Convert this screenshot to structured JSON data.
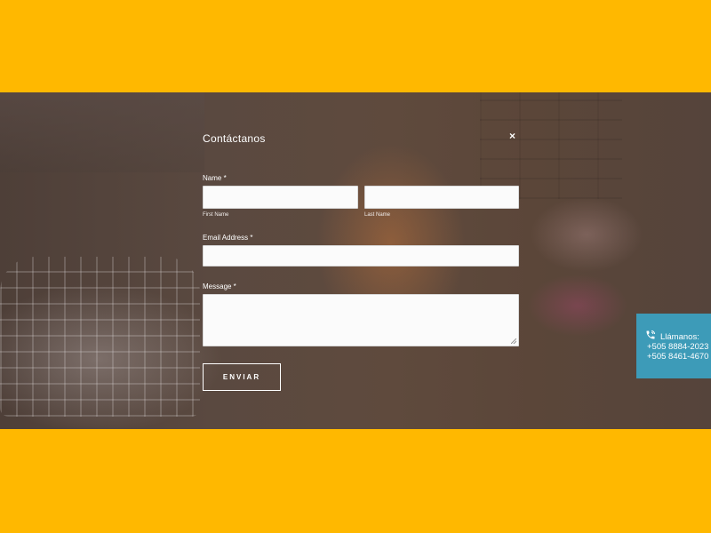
{
  "modal": {
    "title": "Contáctanos",
    "close_symbol": "×"
  },
  "form": {
    "name_label": "Name *",
    "first_name_sublabel": "First Name",
    "last_name_sublabel": "Last Name",
    "first_name_value": "",
    "last_name_value": "",
    "email_label": "Email Address *",
    "email_value": "",
    "message_label": "Message *",
    "message_value": "",
    "submit_label": "ENVIAR"
  },
  "call_widget": {
    "icon": "phone-icon",
    "label": "Llámanos:",
    "phone_1": "+505 8884-2023",
    "phone_2": "+505 8461-4670",
    "background": "#3d9bb8"
  },
  "colors": {
    "brand_band": "#FFB800",
    "overlay": "#5a463c"
  }
}
